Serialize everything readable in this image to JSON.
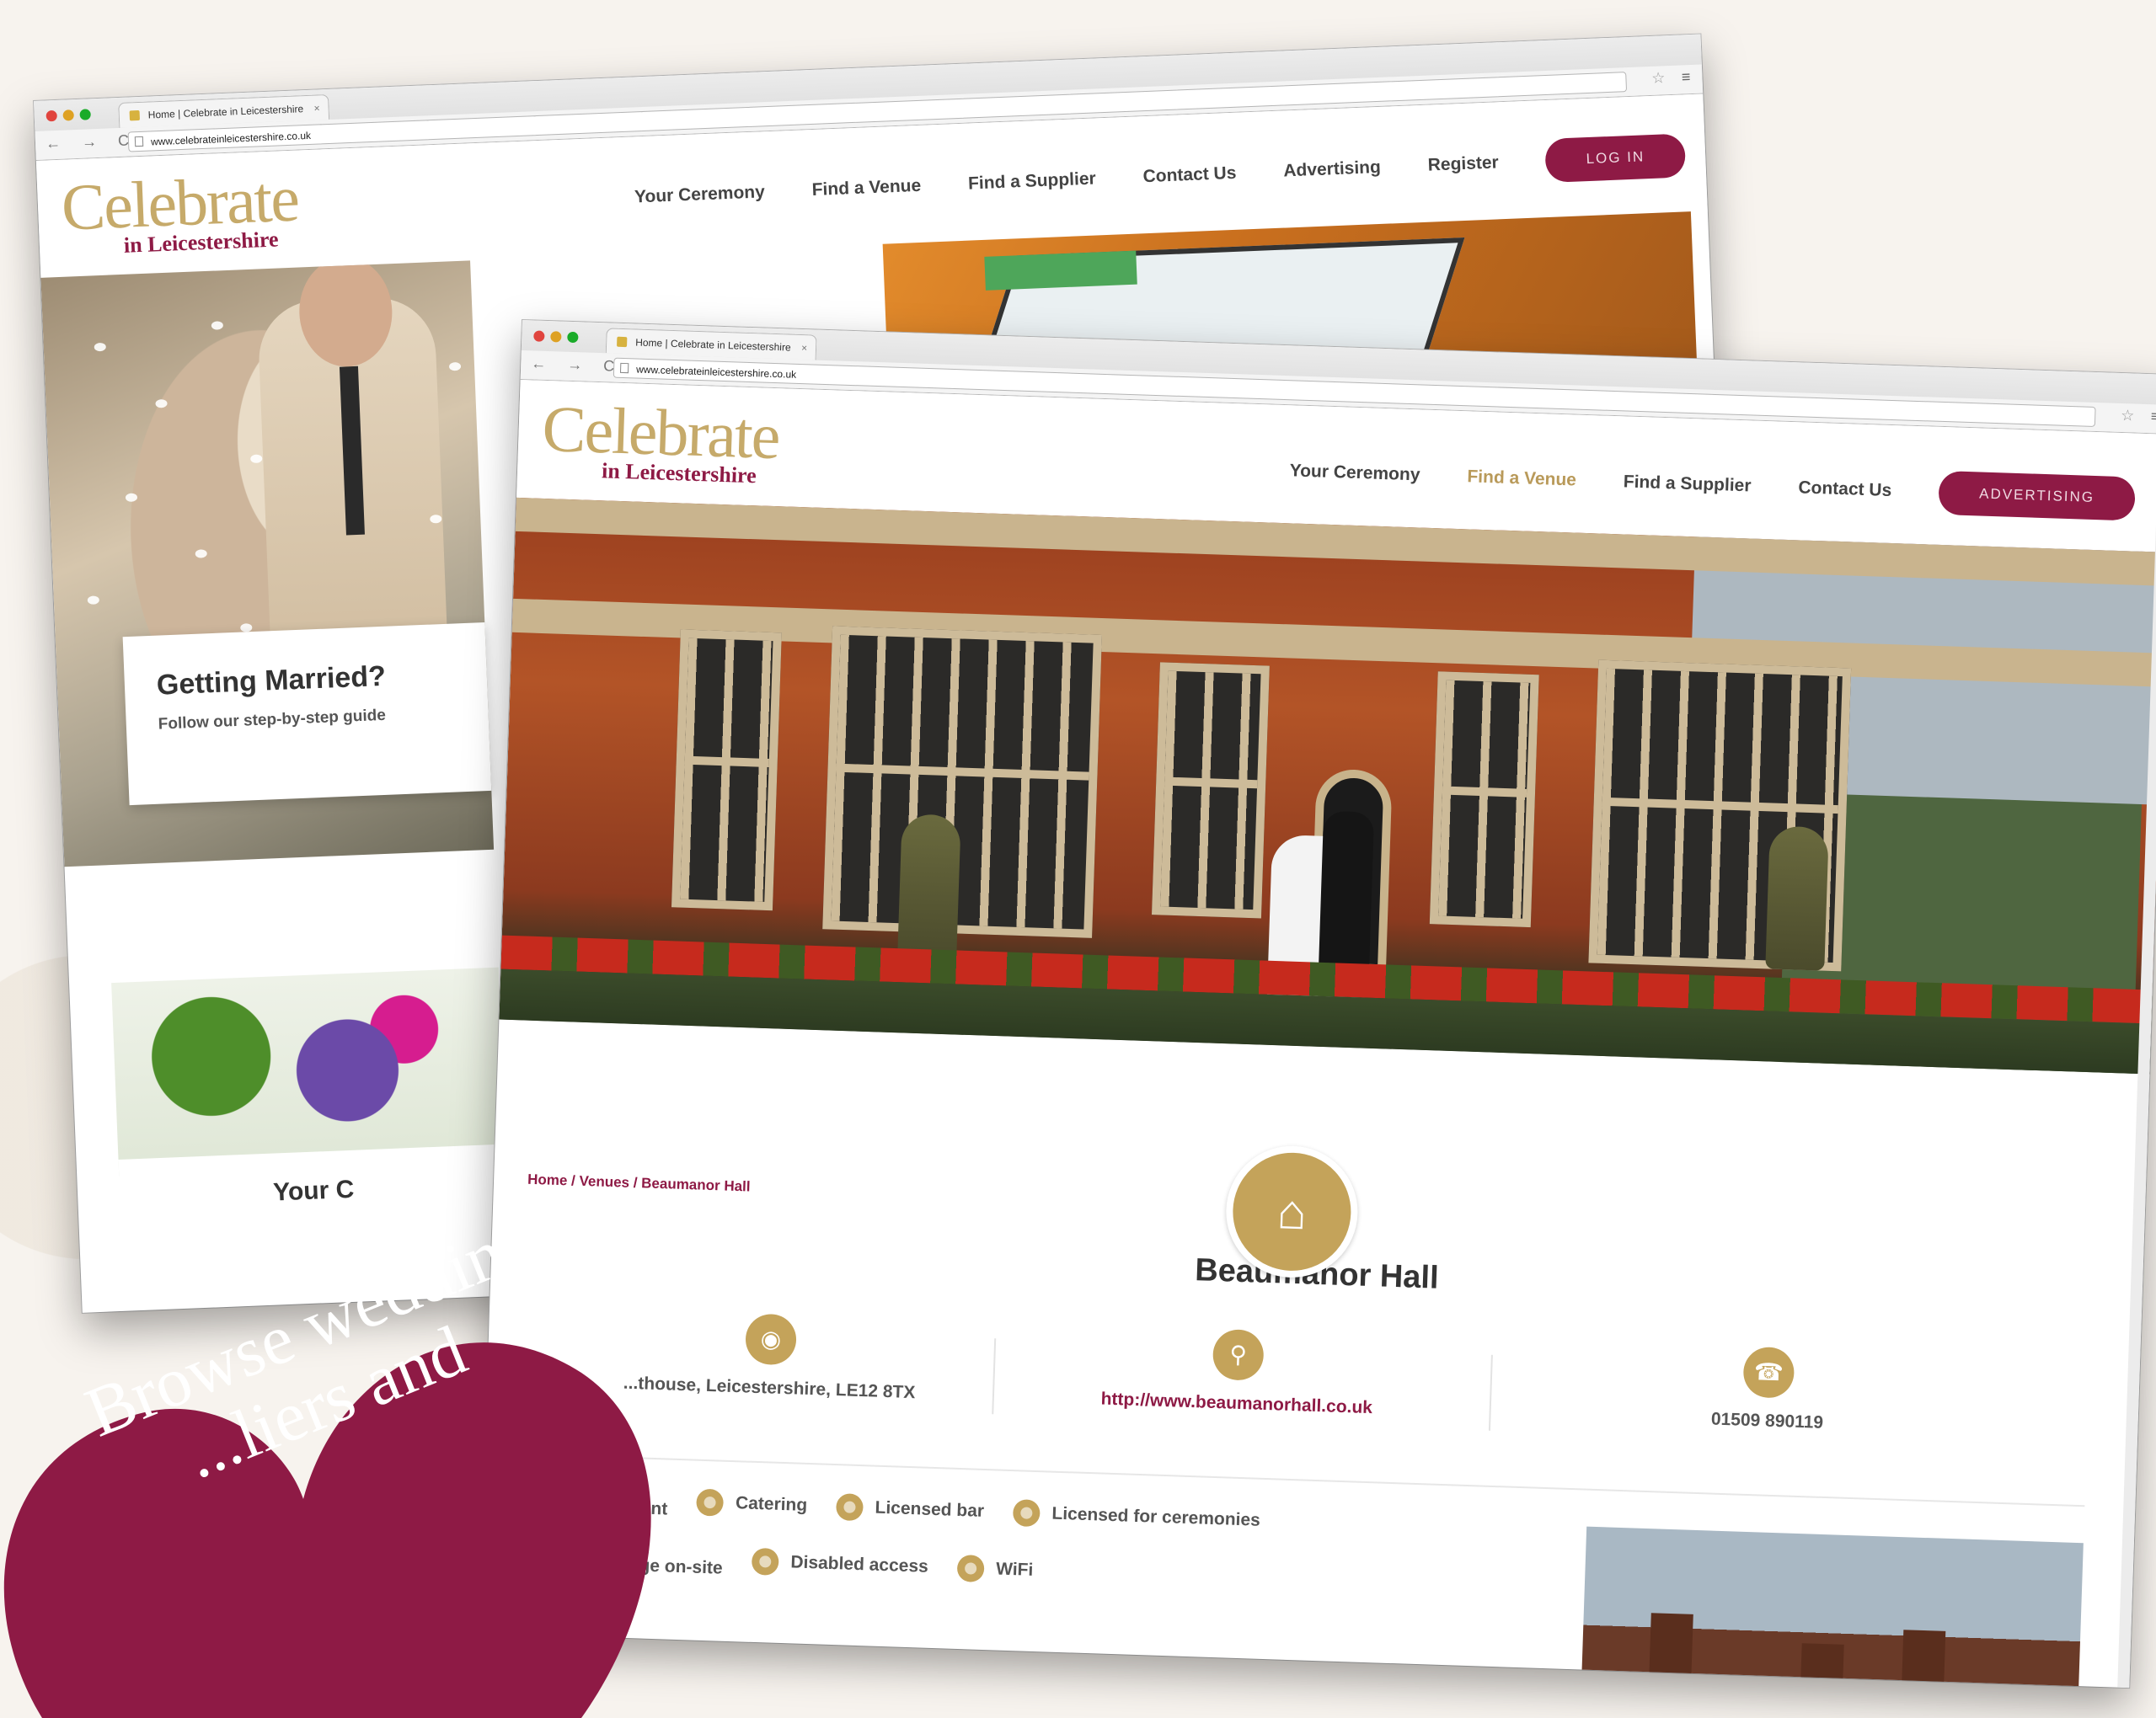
{
  "browser": {
    "tab_title": "Home | Celebrate in Leicestershire",
    "url": "www.celebrateinleicestershire.co.uk",
    "tab_close": "×",
    "nav_glyphs": "← → C",
    "star": "☆",
    "menu": "≡"
  },
  "logo": {
    "main": "Celebrate",
    "sub": "in Leicestershire"
  },
  "back_nav": {
    "items": [
      "Your Ceremony",
      "Find a Venue",
      "Find a Supplier",
      "Contact Us",
      "Advertising",
      "Register"
    ],
    "login_label": "LOG IN"
  },
  "back_page": {
    "card_title": "Getting Married?",
    "card_text": "Follow our step-by-step guide",
    "section_caption": "Your C"
  },
  "front_nav": {
    "items": [
      "Your Ceremony",
      "Find a Venue",
      "Find a Supplier",
      "Contact Us"
    ],
    "active_item": "Find a Venue",
    "advertising_label": "ADVERTISING"
  },
  "venue": {
    "breadcrumb": "Home / Venues / Beaumanor Hall",
    "title": "Beaumanor Hall",
    "address": "...thouse, Leicestershire, LE12 8TX",
    "website": "http://www.beaumanorhall.co.uk",
    "phone": "01509 890119",
    "features": [
      "...ent",
      "Catering",
      "Licensed bar",
      "Licensed for ceremonies",
      "...ge on-site",
      "Disabled access",
      "WiFi"
    ]
  },
  "badge": {
    "line1": "Browse wedding",
    "line2": "...liers and",
    "color": "#8e1a45"
  },
  "colors": {
    "brand": "#8e1a45",
    "gold": "#c4a35a"
  },
  "icons": {
    "location": "location-pin-icon",
    "website": "search-globe-icon",
    "phone": "phone-icon",
    "venue": "venue-building-icon"
  }
}
